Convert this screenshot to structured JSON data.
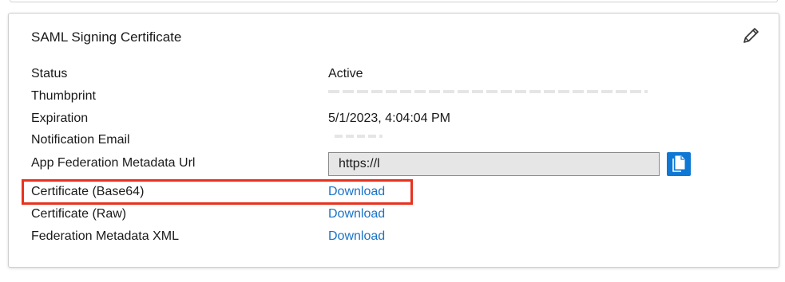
{
  "card": {
    "title": "SAML Signing Certificate",
    "edit_icon": "pencil-icon"
  },
  "rows": {
    "status": {
      "label": "Status",
      "value": "Active"
    },
    "thumbprint": {
      "label": "Thumbprint"
    },
    "expiration": {
      "label": "Expiration",
      "value": "5/1/2023, 4:04:04 PM"
    },
    "notification_email": {
      "label": "Notification Email"
    },
    "metadata_url": {
      "label": "App Federation Metadata Url",
      "value": "https://l",
      "copy_icon": "copy-icon"
    },
    "cert_base64": {
      "label": "Certificate (Base64)",
      "link": "Download"
    },
    "cert_raw": {
      "label": "Certificate (Raw)",
      "link": "Download"
    },
    "federation_xml": {
      "label": "Federation Metadata XML",
      "link": "Download"
    }
  },
  "colors": {
    "link": "#1a73c8",
    "copy_button": "#0f78d4",
    "highlight": "#e8321e"
  }
}
